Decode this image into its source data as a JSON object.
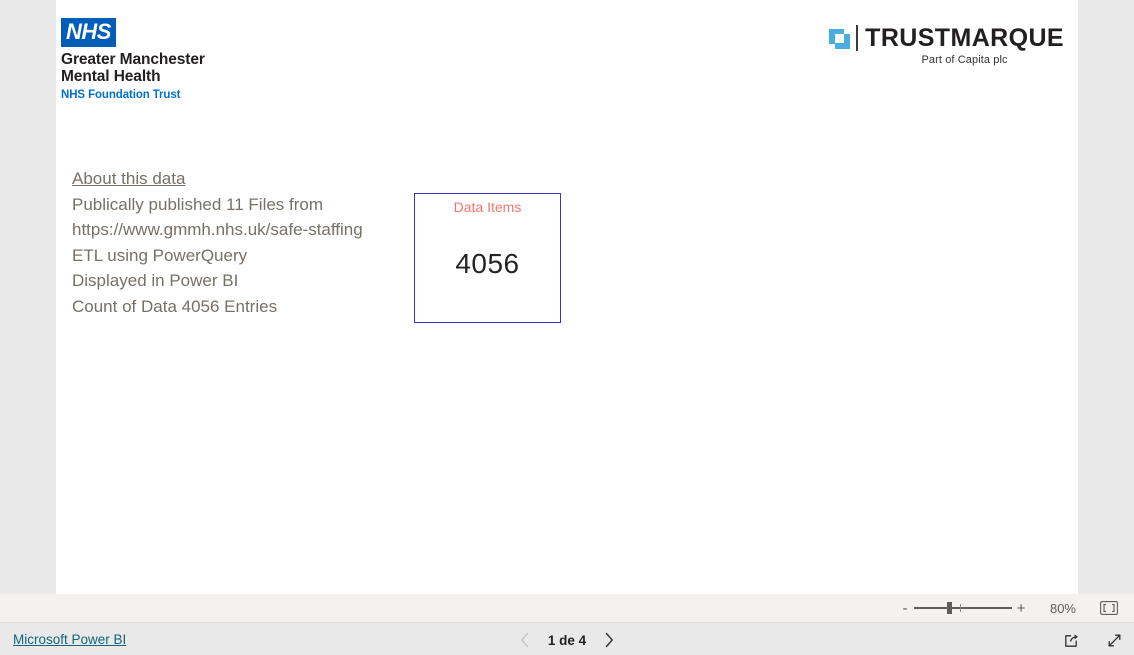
{
  "report": {
    "nhs_logo": {
      "badge": "NHS",
      "trust_line1": "Greater Manchester",
      "trust_line2": "Mental Health",
      "foundation": "NHS Foundation Trust",
      "brand_blue": "#005EB8",
      "foundation_blue": "#0072CE"
    },
    "trustmarque_logo": {
      "name": "TRUSTMARQUE",
      "tagline": "Part of Capita plc",
      "mark_color": "#4BAEE0"
    },
    "about": {
      "heading": "About this data",
      "lines": [
        "Publically published 11 Files from",
        "https://www.gmmh.nhs.uk/safe-staffing",
        "ETL using PowerQuery",
        "Displayed in Power BI",
        "Count of Data 4056 Entries"
      ],
      "text_color": "#777066"
    },
    "kpi_card": {
      "title": "Data Items",
      "value": "4056",
      "title_color": "#f2756d",
      "border_color": "#3333d6"
    }
  },
  "zoom_bar": {
    "minus_label": "-",
    "plus_label": "+",
    "percent": "80%",
    "slider_value": 80,
    "fit_icon": "fit-to-page-icon"
  },
  "footer": {
    "powerbi_link": "Microsoft Power BI",
    "pager": {
      "prev_icon": "chevron-left-icon",
      "next_icon": "chevron-right-icon",
      "label": "1 de 4",
      "current_page": 1,
      "total_pages": 4
    },
    "actions": [
      {
        "name": "share-icon",
        "label": "Share"
      },
      {
        "name": "fullscreen-icon",
        "label": "Full screen"
      }
    ],
    "link_color": "#11667a"
  }
}
